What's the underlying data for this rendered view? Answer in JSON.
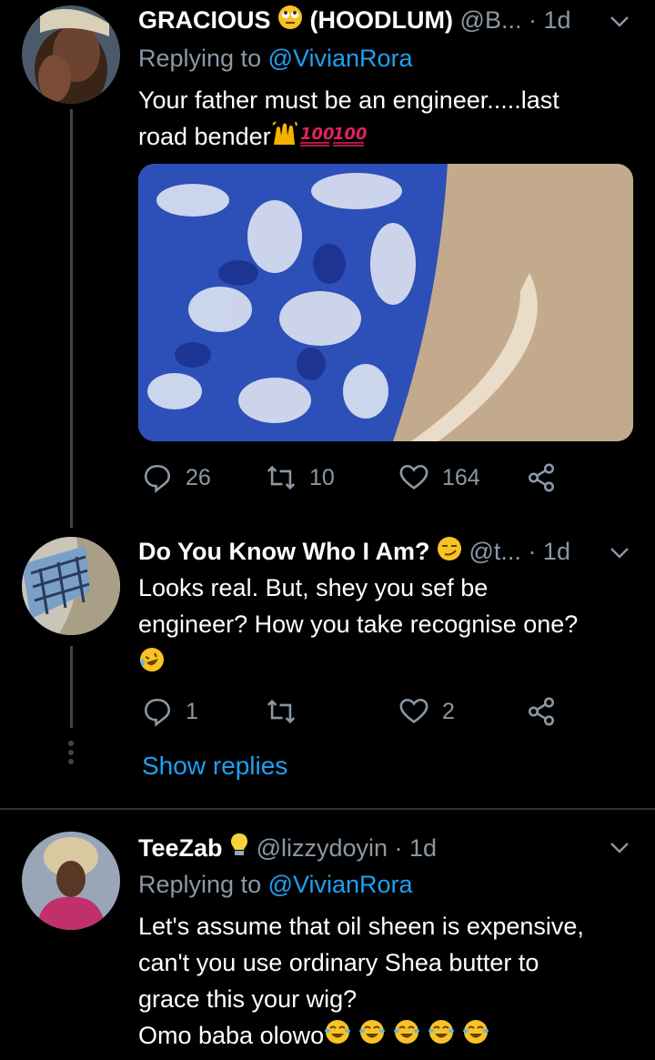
{
  "tweets": [
    {
      "name": "GRACIOUS",
      "name2": "(HOODLUM)",
      "handle": "@B...",
      "time": "· 1d",
      "replying_prefix": "Replying to ",
      "replying_to": "@VivianRora",
      "text_line1": "Your father must be an engineer.....last",
      "text_line2": "road bender",
      "counts": {
        "replies": "26",
        "retweets": "10",
        "likes": "164"
      }
    },
    {
      "name": "Do You Know Who I Am?",
      "handle": "@t...",
      "time": "· 1d",
      "text_line1": "Looks real. But, shey you sef be",
      "text_line2": "engineer? How you take recognise one?",
      "counts": {
        "replies": "1",
        "retweets": "",
        "likes": "2"
      },
      "show_replies": "Show replies"
    },
    {
      "name": "TeeZab",
      "handle": "@lizzydoyin",
      "time": "· 1d",
      "replying_prefix": "Replying to ",
      "replying_to": "@VivianRora",
      "text_line1": "Let's assume that oil sheen is expensive,",
      "text_line2": "can't you use ordinary Shea butter to",
      "text_line3": "grace this your wig?",
      "text_line4": "Omo baba olowo"
    }
  ],
  "icons": {
    "reply": "reply-icon",
    "retweet": "retweet-icon",
    "like": "heart-icon",
    "share": "share-icon",
    "more": "chevron-down-icon"
  },
  "colors": {
    "background": "#000000",
    "link": "#1da1f2",
    "secondary_text": "#8b98a5",
    "divider": "#2f3336"
  }
}
